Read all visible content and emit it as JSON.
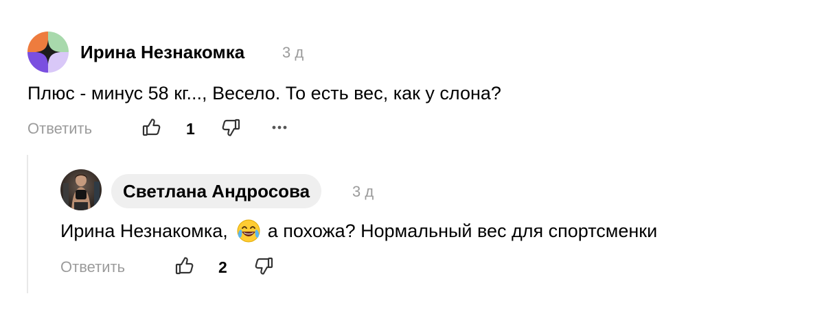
{
  "comments": [
    {
      "author": "Ирина Незнакомка",
      "time": "3 д",
      "text": "Плюс - минус 58 кг..., Весело. То есть вес, как у слона?",
      "reply_label": "Ответить",
      "likes": "1",
      "more_label": "···"
    },
    {
      "author": "Светлана Андросова",
      "time": "3 д",
      "text_before_emoji": "Ирина Незнакомка,",
      "emoji_name": "face-with-tears-of-joy",
      "text_after_emoji": "а похожа? Нормальный вес для спортсменки",
      "reply_label": "Ответить",
      "likes": "2"
    }
  ],
  "colors": {
    "muted_text": "#9b9b9b",
    "thread_line": "#e8e8e8",
    "author_pill_bg": "#efefef"
  }
}
